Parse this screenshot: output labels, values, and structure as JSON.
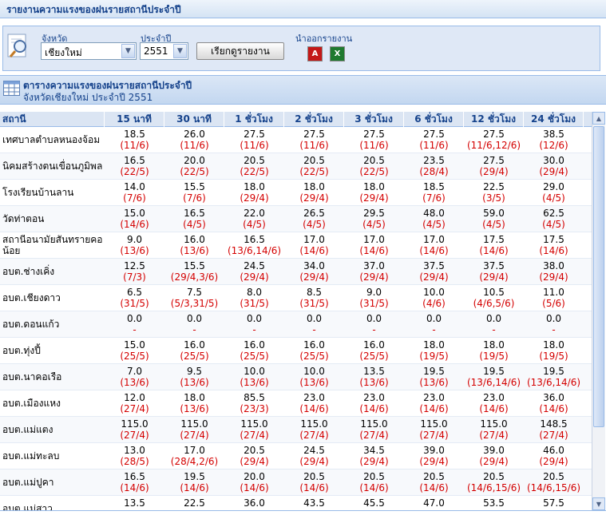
{
  "page": {
    "title": "รายงานความแรงของฝนรายสถานีประจำปี"
  },
  "filter": {
    "province_label": "จังหวัด",
    "province_value": "เชียงใหม่",
    "year_label": "ประจำปี",
    "year_value": "2551",
    "submit_label": "เรียกดูรายงาน",
    "export_label": "นำออกรายงาน"
  },
  "panel": {
    "title": "ตารางความแรงของฝนรายสถานีประจำปี",
    "subtitle": "จังหวัดเชียงใหม่ ประจำปี 2551"
  },
  "table": {
    "headers": [
      "สถานี",
      "15 นาที",
      "30 นาที",
      "1 ชั่วโมง",
      "2 ชั่วโมง",
      "3 ชั่วโมง",
      "6 ชั่วโมง",
      "12 ชั่วโมง",
      "24 ชั่วโมง"
    ],
    "rows": [
      {
        "station": "เทศบาลตำบลหนองจ้อม",
        "cells": [
          [
            "18.5",
            "(11/6)"
          ],
          [
            "26.0",
            "(11/6)"
          ],
          [
            "27.5",
            "(11/6)"
          ],
          [
            "27.5",
            "(11/6)"
          ],
          [
            "27.5",
            "(11/6)"
          ],
          [
            "27.5",
            "(11/6)"
          ],
          [
            "27.5",
            "(11/6,12/6)"
          ],
          [
            "38.5",
            "(12/6)"
          ]
        ]
      },
      {
        "station": "นิคมสร้างตนเขื่อนภูมิพล",
        "cells": [
          [
            "16.5",
            "(22/5)"
          ],
          [
            "20.0",
            "(22/5)"
          ],
          [
            "20.5",
            "(22/5)"
          ],
          [
            "20.5",
            "(22/5)"
          ],
          [
            "20.5",
            "(22/5)"
          ],
          [
            "23.5",
            "(28/4)"
          ],
          [
            "27.5",
            "(29/4)"
          ],
          [
            "30.0",
            "(29/4)"
          ]
        ]
      },
      {
        "station": "โรงเรียนบ้านลาน",
        "cells": [
          [
            "14.0",
            "(7/6)"
          ],
          [
            "15.5",
            "(7/6)"
          ],
          [
            "18.0",
            "(29/4)"
          ],
          [
            "18.0",
            "(29/4)"
          ],
          [
            "18.0",
            "(29/4)"
          ],
          [
            "18.5",
            "(7/6)"
          ],
          [
            "22.5",
            "(3/5)"
          ],
          [
            "29.0",
            "(4/5)"
          ]
        ]
      },
      {
        "station": "วัดท่าตอน",
        "cells": [
          [
            "15.0",
            "(14/6)"
          ],
          [
            "16.5",
            "(4/5)"
          ],
          [
            "22.0",
            "(4/5)"
          ],
          [
            "26.5",
            "(4/5)"
          ],
          [
            "29.5",
            "(4/5)"
          ],
          [
            "48.0",
            "(4/5)"
          ],
          [
            "59.0",
            "(4/5)"
          ],
          [
            "62.5",
            "(4/5)"
          ]
        ]
      },
      {
        "station": "สถานีอนามัยสันทรายคอน้อย",
        "cells": [
          [
            "9.0",
            "(13/6)"
          ],
          [
            "16.0",
            "(13/6)"
          ],
          [
            "16.5",
            "(13/6,14/6)"
          ],
          [
            "17.0",
            "(14/6)"
          ],
          [
            "17.0",
            "(14/6)"
          ],
          [
            "17.0",
            "(14/6)"
          ],
          [
            "17.5",
            "(14/6)"
          ],
          [
            "17.5",
            "(14/6)"
          ]
        ]
      },
      {
        "station": "อบต.ช่างเคิ่ง",
        "cells": [
          [
            "12.5",
            "(7/3)"
          ],
          [
            "15.5",
            "(29/4,3/6)"
          ],
          [
            "24.5",
            "(29/4)"
          ],
          [
            "34.0",
            "(29/4)"
          ],
          [
            "37.0",
            "(29/4)"
          ],
          [
            "37.5",
            "(29/4)"
          ],
          [
            "37.5",
            "(29/4)"
          ],
          [
            "38.0",
            "(29/4)"
          ]
        ]
      },
      {
        "station": "อบต.เชียงดาว",
        "cells": [
          [
            "6.5",
            "(31/5)"
          ],
          [
            "7.5",
            "(5/3,31/5)"
          ],
          [
            "8.0",
            "(31/5)"
          ],
          [
            "8.5",
            "(31/5)"
          ],
          [
            "9.0",
            "(31/5)"
          ],
          [
            "10.0",
            "(4/6)"
          ],
          [
            "10.5",
            "(4/6,5/6)"
          ],
          [
            "11.0",
            "(5/6)"
          ]
        ]
      },
      {
        "station": "อบต.ดอนแก้ว",
        "cells": [
          [
            "0.0",
            "-"
          ],
          [
            "0.0",
            "-"
          ],
          [
            "0.0",
            "-"
          ],
          [
            "0.0",
            "-"
          ],
          [
            "0.0",
            "-"
          ],
          [
            "0.0",
            "-"
          ],
          [
            "0.0",
            "-"
          ],
          [
            "0.0",
            "-"
          ]
        ]
      },
      {
        "station": "อบต.ทุ่งปี้",
        "cells": [
          [
            "15.0",
            "(25/5)"
          ],
          [
            "16.0",
            "(25/5)"
          ],
          [
            "16.0",
            "(25/5)"
          ],
          [
            "16.0",
            "(25/5)"
          ],
          [
            "16.0",
            "(25/5)"
          ],
          [
            "18.0",
            "(19/5)"
          ],
          [
            "18.0",
            "(19/5)"
          ],
          [
            "18.0",
            "(19/5)"
          ]
        ]
      },
      {
        "station": "อบต.นาคอเรือ",
        "cells": [
          [
            "7.0",
            "(13/6)"
          ],
          [
            "9.5",
            "(13/6)"
          ],
          [
            "10.0",
            "(13/6)"
          ],
          [
            "10.0",
            "(13/6)"
          ],
          [
            "13.5",
            "(13/6)"
          ],
          [
            "19.5",
            "(13/6)"
          ],
          [
            "19.5",
            "(13/6,14/6)"
          ],
          [
            "19.5",
            "(13/6,14/6)"
          ]
        ]
      },
      {
        "station": "อบต.เมืองแหง",
        "cells": [
          [
            "12.0",
            "(27/4)"
          ],
          [
            "18.0",
            "(13/6)"
          ],
          [
            "85.5",
            "(23/3)"
          ],
          [
            "23.0",
            "(14/6)"
          ],
          [
            "23.0",
            "(14/6)"
          ],
          [
            "23.0",
            "(14/6)"
          ],
          [
            "23.0",
            "(14/6)"
          ],
          [
            "36.0",
            "(14/6)"
          ]
        ]
      },
      {
        "station": "อบต.แม่แตง",
        "cells": [
          [
            "115.0",
            "(27/4)"
          ],
          [
            "115.0",
            "(27/4)"
          ],
          [
            "115.0",
            "(27/4)"
          ],
          [
            "115.0",
            "(27/4)"
          ],
          [
            "115.0",
            "(27/4)"
          ],
          [
            "115.0",
            "(27/4)"
          ],
          [
            "115.0",
            "(27/4)"
          ],
          [
            "148.5",
            "(27/4)"
          ]
        ]
      },
      {
        "station": "อบต.แม่ทะลบ",
        "cells": [
          [
            "13.0",
            "(28/5)"
          ],
          [
            "17.0",
            "(28/4,2/6)"
          ],
          [
            "20.5",
            "(29/4)"
          ],
          [
            "24.5",
            "(29/4)"
          ],
          [
            "34.5",
            "(29/4)"
          ],
          [
            "39.0",
            "(29/4)"
          ],
          [
            "39.0",
            "(29/4)"
          ],
          [
            "46.0",
            "(29/4)"
          ]
        ]
      },
      {
        "station": "อบต.แม่ปูคา",
        "cells": [
          [
            "16.5",
            "(14/6)"
          ],
          [
            "19.5",
            "(14/6)"
          ],
          [
            "20.0",
            "(14/6)"
          ],
          [
            "20.5",
            "(14/6)"
          ],
          [
            "20.5",
            "(14/6)"
          ],
          [
            "20.5",
            "(14/6)"
          ],
          [
            "20.5",
            "(14/6,15/6)"
          ],
          [
            "20.5",
            "(14/6,15/6)"
          ]
        ]
      },
      {
        "station": "อบต.แม่สาว",
        "cells": [
          [
            "13.5",
            ""
          ],
          [
            "22.5",
            ""
          ],
          [
            "36.0",
            ""
          ],
          [
            "43.5",
            ""
          ],
          [
            "45.5",
            ""
          ],
          [
            "47.0",
            ""
          ],
          [
            "53.5",
            ""
          ],
          [
            "57.5",
            ""
          ]
        ]
      }
    ]
  },
  "icons": {
    "search": "magnifier-icon",
    "grid": "grid-icon",
    "pdf": "pdf-icon",
    "excel": "excel-icon"
  }
}
